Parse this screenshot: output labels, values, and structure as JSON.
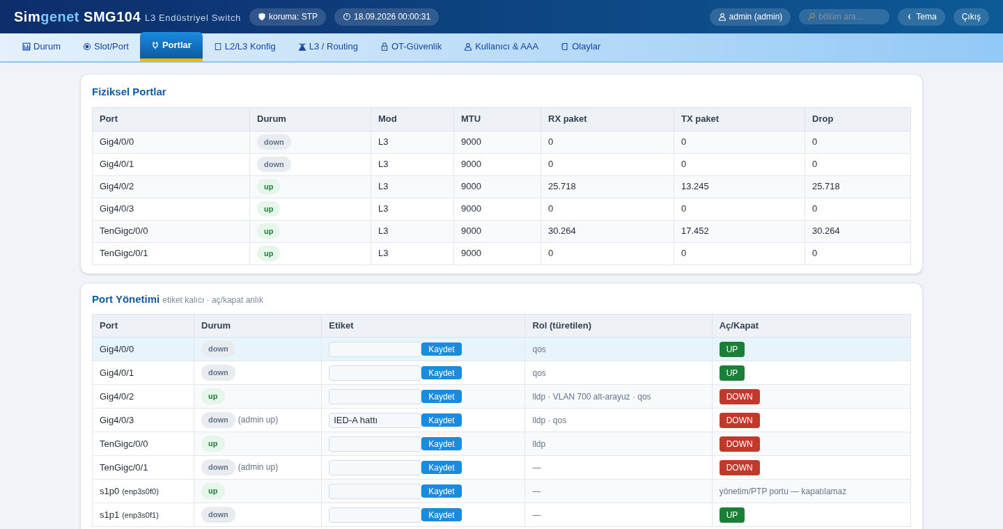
{
  "header": {
    "brand_prefix": "Sim",
    "brand_accent": "genet",
    "model": "SMG104",
    "subtitle": "L3 Endüstriyel Switch",
    "pills": [
      {
        "label": "koruma: STP"
      },
      {
        "label": "18.09.2026 00:00:31"
      }
    ],
    "user": "admin (admin)",
    "search": {
      "placeholder": "bölüm ara..."
    },
    "theme_button": "Tema",
    "logout_button": "Çıkış"
  },
  "tabs": [
    {
      "label": "Durum",
      "selected": false
    },
    {
      "label": "Slot/Port",
      "selected": false
    },
    {
      "label": "Portlar",
      "selected": true
    },
    {
      "label": "L2/L3 Konfig",
      "selected": false
    },
    {
      "label": "L3 / Routing",
      "selected": false
    },
    {
      "label": "OT-Güvenlik",
      "selected": false
    },
    {
      "label": "Kullanıcı & AAA",
      "selected": false
    },
    {
      "label": "Olaylar",
      "selected": false
    }
  ],
  "physical_ports": {
    "title": "Fiziksel Portlar",
    "columns": [
      "Port",
      "Durum",
      "Mod",
      "MTU",
      "RX paket",
      "TX paket",
      "Drop"
    ],
    "rows": [
      {
        "port": "Gig4/0/0",
        "status": "down",
        "up": false,
        "mode": "L3",
        "mtu": "9000",
        "rx": "0",
        "tx": "0",
        "drop": "0"
      },
      {
        "port": "Gig4/0/1",
        "status": "down",
        "up": false,
        "mode": "L3",
        "mtu": "9000",
        "rx": "0",
        "tx": "0",
        "drop": "0"
      },
      {
        "port": "Gig4/0/2",
        "status": "up",
        "up": true,
        "mode": "L3",
        "mtu": "9000",
        "rx": "25.718",
        "tx": "13.245",
        "drop": "25.718"
      },
      {
        "port": "Gig4/0/3",
        "status": "up",
        "up": true,
        "mode": "L3",
        "mtu": "9000",
        "rx": "0",
        "tx": "0",
        "drop": "0"
      },
      {
        "port": "TenGigc/0/0",
        "status": "up",
        "up": true,
        "mode": "L3",
        "mtu": "9000",
        "rx": "30.264",
        "tx": "17.452",
        "drop": "30.264"
      },
      {
        "port": "TenGigc/0/1",
        "status": "up",
        "up": true,
        "mode": "L3",
        "mtu": "9000",
        "rx": "0",
        "tx": "0",
        "drop": "0"
      }
    ]
  },
  "port_management": {
    "title": "Port Yönetimi",
    "subtitle": "etiket kalıcı · aç/kapat anlık",
    "columns": [
      "Port",
      "Durum",
      "Etiket",
      "Rol (türetilen)",
      "Aç/Kapat"
    ],
    "rows": [
      {
        "port": "Gig4/0/0",
        "status": "down",
        "up": false,
        "selected": true,
        "label_value": "",
        "save": "Kaydet",
        "role": "qos",
        "toggle": {
          "kind": "button",
          "label": "UP",
          "on": true
        }
      },
      {
        "port": "Gig4/0/1",
        "status": "down",
        "up": false,
        "selected": false,
        "label_value": "",
        "save": "Kaydet",
        "role": "qos",
        "toggle": {
          "kind": "button",
          "label": "UP",
          "on": true
        }
      },
      {
        "port": "Gig4/0/2",
        "status": "up",
        "up": true,
        "selected": false,
        "label_value": "",
        "save": "Kaydet",
        "role": "lldp · VLAN 700 alt-arayuz · qos",
        "toggle": {
          "kind": "button",
          "label": "DOWN",
          "on": false
        }
      },
      {
        "port": "Gig4/0/3",
        "status": "down",
        "up": false,
        "admin_note": "(admin up)",
        "selected": false,
        "label_value": "IED-A hattı",
        "save": "Kaydet",
        "role": "lldp · qos",
        "toggle": {
          "kind": "button",
          "label": "DOWN",
          "on": false
        }
      },
      {
        "port": "TenGigc/0/0",
        "status": "up",
        "up": true,
        "selected": false,
        "label_value": "",
        "save": "Kaydet",
        "role": "lldp",
        "toggle": {
          "kind": "button",
          "label": "DOWN",
          "on": false
        }
      },
      {
        "port": "TenGigc/0/1",
        "status": "down",
        "up": false,
        "admin_note": "(admin up)",
        "selected": false,
        "label_value": "",
        "save": "Kaydet",
        "role": "—",
        "toggle": {
          "kind": "button",
          "label": "DOWN",
          "on": false
        }
      },
      {
        "port": "s1p0",
        "port_detail": "(enp3s0f0)",
        "status": "up",
        "up": true,
        "selected": false,
        "label_value": "",
        "save": "Kaydet",
        "role": "—",
        "toggle": {
          "kind": "note",
          "label": "yönetim/PTP portu — kapatılamaz"
        }
      },
      {
        "port": "s1p1",
        "port_detail": "(enp3s0f1)",
        "status": "down",
        "up": false,
        "selected": false,
        "label_value": "",
        "save": "Kaydet",
        "role": "—",
        "toggle": {
          "kind": "button",
          "label": "UP",
          "on": true
        }
      }
    ]
  }
}
